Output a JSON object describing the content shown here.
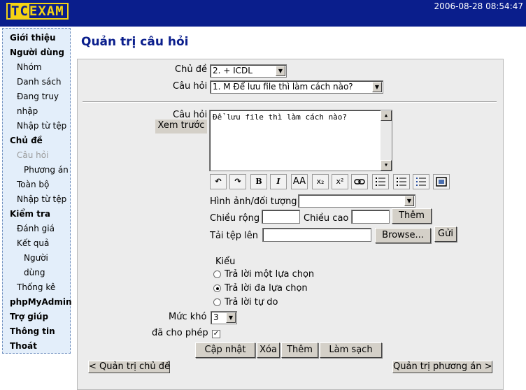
{
  "header": {
    "logo_tc": "TC",
    "logo_exam": "EXAM",
    "datetime": "2006-08-28 08:54:47"
  },
  "sidebar": {
    "items": [
      {
        "label": "Giới thiệu"
      },
      {
        "label": "Người dùng"
      },
      {
        "label": "Nhóm"
      },
      {
        "label": "Danh sách"
      },
      {
        "label": "Đang truy"
      },
      {
        "label": "nhập"
      },
      {
        "label": "Nhập từ tệp"
      },
      {
        "label": "Chủ đề"
      },
      {
        "label": "Câu hỏi"
      },
      {
        "label": "Phương án"
      },
      {
        "label": "Toàn bộ"
      },
      {
        "label": "Nhập từ tệp"
      },
      {
        "label": "Kiểm tra"
      },
      {
        "label": "Đánh giá"
      },
      {
        "label": "Kết quả"
      },
      {
        "label": "Người"
      },
      {
        "label": "dùng"
      },
      {
        "label": "Thống kê"
      },
      {
        "label": "phpMyAdmin"
      },
      {
        "label": "Trợ giúp"
      },
      {
        "label": "Thông tin"
      },
      {
        "label": "Thoát"
      }
    ]
  },
  "page_title": "Quản trị câu hỏi",
  "form": {
    "subject_label": "Chủ đề",
    "subject_value": "2. + ICDL",
    "question_select_label": "Câu hỏi",
    "question_select_value": "1. M Để lưu file thì làm cách nào?",
    "question_label": "Câu hỏi",
    "preview_button": "Xem trước",
    "question_text": "Để lưu file thì làm cách nào?",
    "toolbar": {
      "bold": "B",
      "italic": "I",
      "fontsize": "AA",
      "sub": "x₂",
      "sup": "x²",
      "undo": "↶",
      "redo": "↷"
    },
    "media_label": "Hình ảnh/đối tượng",
    "media_value": "",
    "width_label": "Chiều rộng",
    "height_label": "Chiều cao",
    "add_button": "Thêm",
    "upload_label": "Tải tệp lên",
    "browse_button": "Browse...",
    "send_button": "Gửi",
    "type_label": "Kiểu",
    "type_options": [
      "Trả lời một lựa chọn",
      "Trả lời đa lựa chọn",
      "Trả lời tự do"
    ],
    "type_selected": 1,
    "difficulty_label": "Mức khó",
    "difficulty_value": "3",
    "enabled_label": "đã cho phép",
    "enabled": true,
    "actions": {
      "update": "Cập nhật",
      "delete": "Xóa",
      "add": "Thêm",
      "clear": "Làm sạch"
    },
    "nav_prev": "< Quản trị chủ đề",
    "nav_next": "Quản trị phương án >"
  },
  "colors": {
    "header_bg": "#0a1e8c",
    "logo": "#f4d313",
    "sidebar_bg": "#e3eefa",
    "title": "#0a1e8c",
    "panel_bg": "#ececec"
  }
}
